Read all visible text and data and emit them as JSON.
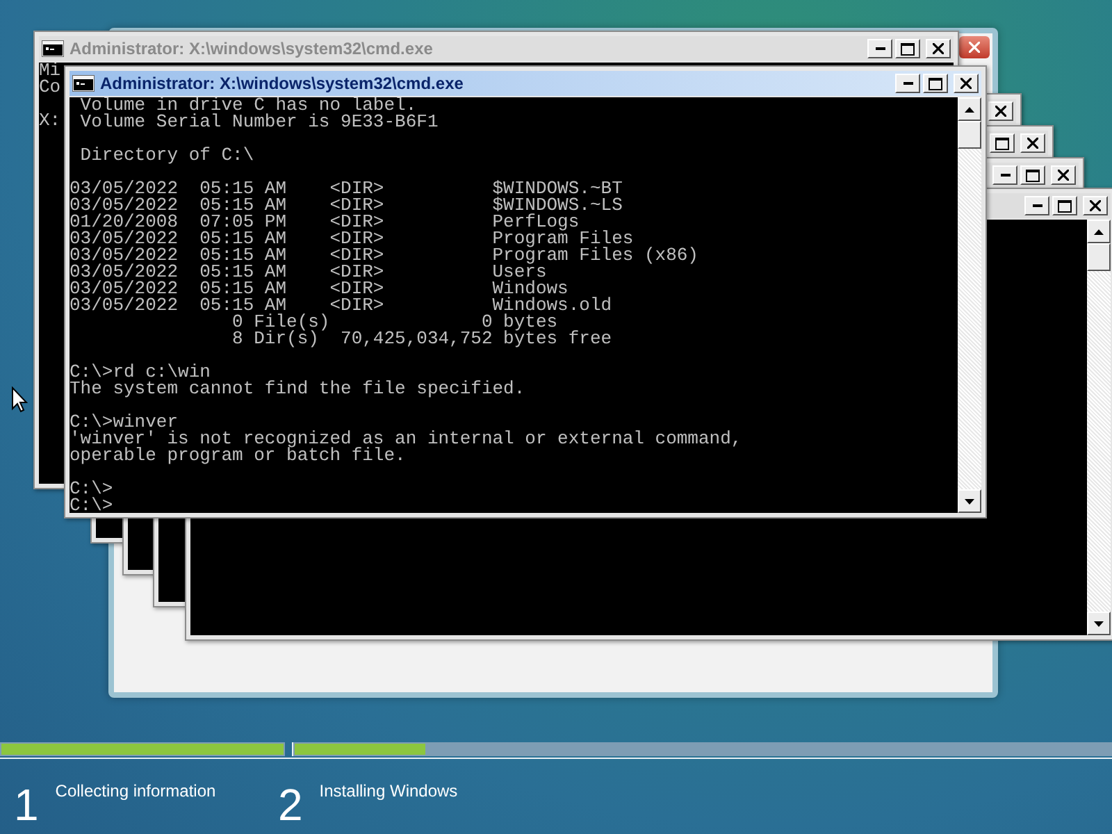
{
  "console_windows": [
    {
      "title": "Administrator: X:\\windows\\system32\\cmd.exe",
      "active": false,
      "blocks": [
        [
          "Mi",
          "Co"
        ],
        [
          "X:"
        ]
      ]
    },
    {
      "active": false
    },
    {
      "active": false
    },
    {
      "active": false
    },
    {
      "active": false
    },
    {
      "title": "Administrator: X:\\windows\\system32\\cmd.exe",
      "active": true,
      "blocks": [
        [
          " Volume in drive C has no label.",
          " Volume Serial Number is 9E33-B6F1"
        ],
        [
          " Directory of C:\\"
        ],
        [
          "03/05/2022  05:15 AM    <DIR>          $WINDOWS.~BT",
          "03/05/2022  05:15 AM    <DIR>          $WINDOWS.~LS",
          "01/20/2008  07:05 PM    <DIR>          PerfLogs",
          "03/05/2022  05:15 AM    <DIR>          Program Files",
          "03/05/2022  05:15 AM    <DIR>          Program Files (x86)",
          "03/05/2022  05:15 AM    <DIR>          Users",
          "03/05/2022  05:15 AM    <DIR>          Windows",
          "03/05/2022  05:15 AM    <DIR>          Windows.old",
          "               0 File(s)              0 bytes",
          "               8 Dir(s)  70,425,034,752 bytes free"
        ],
        [
          "C:\\>rd c:\\win",
          "The system cannot find the file specified."
        ],
        [
          "C:\\>winver",
          "'winver' is not recognized as an internal or external command,",
          "operable program or batch file."
        ],
        [
          "C:\\>",
          "C:\\>"
        ]
      ]
    }
  ],
  "setup_progress": [
    {
      "number": "1",
      "label": "Collecting information",
      "level": 1
    },
    {
      "number": "2",
      "label": "Installing Windows",
      "level": 0.16
    }
  ]
}
